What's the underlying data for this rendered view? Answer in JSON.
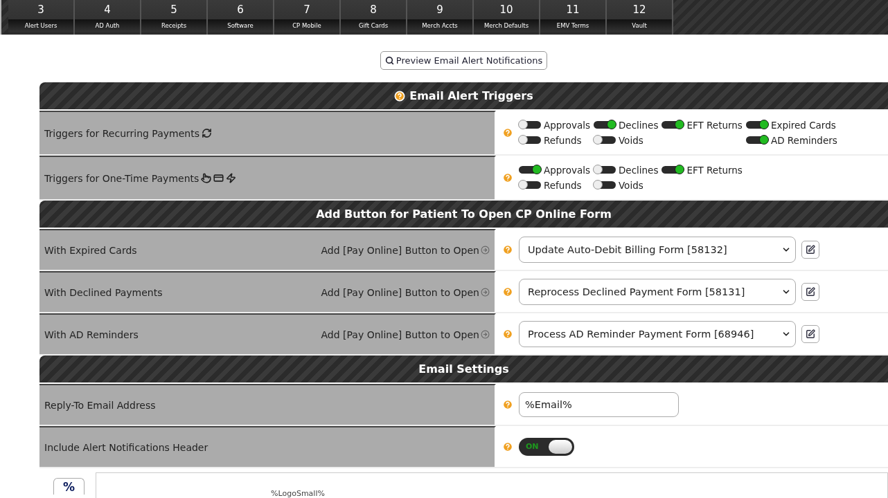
{
  "nav_tabs": [
    {
      "number": "3",
      "label": "Alert Users",
      "selected": false
    },
    {
      "number": "4",
      "label": "AD Auth",
      "selected": false
    },
    {
      "number": "5",
      "label": "Receipts",
      "selected": false
    },
    {
      "number": "6",
      "label": "Software",
      "selected": false
    },
    {
      "number": "7",
      "label": "CP Mobile",
      "selected": false
    },
    {
      "number": "8",
      "label": "Gift Cards",
      "selected": false
    },
    {
      "number": "9",
      "label": "Merch Accts",
      "selected": false
    },
    {
      "number": "10",
      "label": "Merch Defaults",
      "selected": false
    },
    {
      "number": "11",
      "label": "EMV Terms",
      "selected": false
    },
    {
      "number": "12",
      "label": "Vault",
      "selected": false
    }
  ],
  "preview_button": "Preview Email Alert Notifications",
  "sections": [
    {
      "title": "Email Alert Triggers",
      "help": true,
      "rows": [
        {
          "kind": "recurring",
          "label": "Triggers for Recurring Payments",
          "toggle_rows": [
            [
              {
                "label": "Approvals",
                "on": false
              },
              {
                "label": "Declines",
                "on": true
              },
              {
                "label": "EFT Returns",
                "on": true
              },
              {
                "label": "Expired Cards",
                "on": true
              }
            ],
            [
              {
                "label": "Refunds",
                "on": false
              },
              {
                "label": "Voids",
                "on": false
              },
              null,
              {
                "label": "AD Reminders",
                "on": true
              }
            ]
          ]
        },
        {
          "kind": "onetime",
          "label": "Triggers for One-Time Payments",
          "toggle_rows": [
            [
              {
                "label": "Approvals",
                "on": true
              },
              {
                "label": "Declines",
                "on": false
              },
              {
                "label": "EFT Returns",
                "on": true
              }
            ],
            [
              {
                "label": "Refunds",
                "on": false
              },
              {
                "label": "Voids",
                "on": false
              }
            ]
          ]
        }
      ]
    },
    {
      "title": "Add Button for Patient To Open CP Online Form",
      "help": false,
      "rows": [
        {
          "kind": "select",
          "label": "With Expired Cards",
          "note": "Add [Pay Online] Button to Open",
          "value": "Update Auto-Debit Billing Form [58132]"
        },
        {
          "kind": "select",
          "label": "With Declined Payments",
          "note": "Add [Pay Online] Button to Open",
          "value": "Reprocess Declined Payment Form [58131]"
        },
        {
          "kind": "select",
          "label": "With AD Reminders",
          "note": "Add [Pay Online] Button to Open",
          "value": "Process AD Reminder Payment Form [68946]"
        }
      ]
    },
    {
      "title": "Email Settings",
      "help": false,
      "rows": [
        {
          "kind": "text",
          "label": "Reply-To Email Address",
          "value": "%Email%"
        },
        {
          "kind": "switch",
          "label": "Include Alert Notifications Header",
          "on": true,
          "switch_text": "ON"
        }
      ]
    }
  ],
  "footer": {
    "button": "%",
    "logo_text": "%LogoSmall%"
  }
}
